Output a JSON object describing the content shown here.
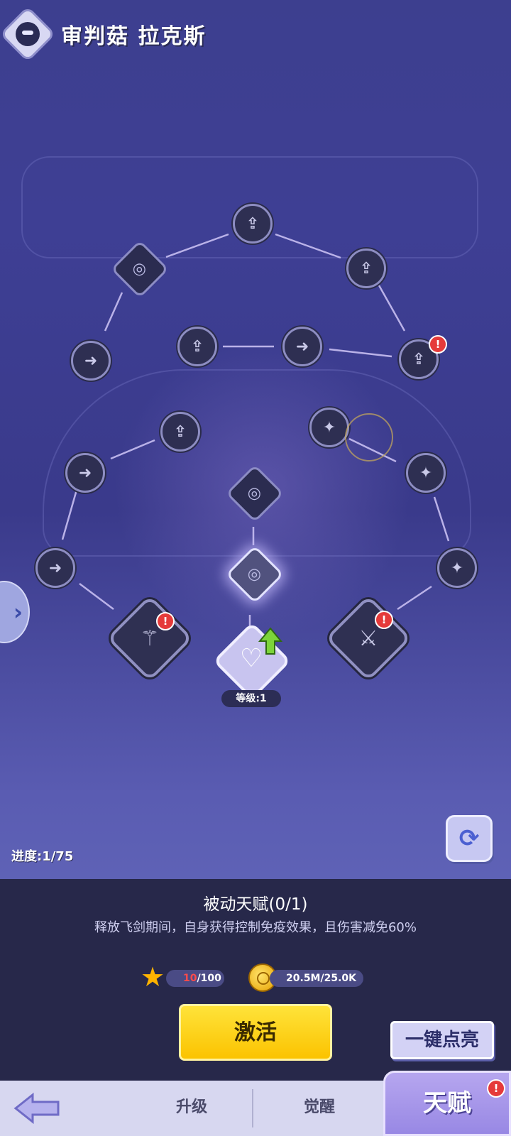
{
  "header": {
    "title": "审判菇 拉克斯",
    "avatar_icon": "hooded-mushroom-icon"
  },
  "tree": {
    "level_label": "等级:1",
    "badge_text": "!",
    "icons": {
      "node_small": "talent-node-icon",
      "node_diamond": "vortex-diamond-icon",
      "staff": "staff-icon",
      "sword": "sword-icon",
      "heart": "heart-plus-icon",
      "upgrade": "green-up-arrow-icon"
    }
  },
  "progress": "进度:1/75",
  "panel": {
    "title": "被动天赋(0/1)",
    "description": "释放飞剑期间，自身获得控制免疫效果，且伤害减免60%",
    "cost_star_current": "10",
    "cost_star_total": "/100",
    "cost_gold": "20.5M/25.0K",
    "activate_label": "激活",
    "one_key_label": "一键点亮"
  },
  "tabs": {
    "upgrade": "升级",
    "awaken": "觉醒",
    "talent": "天赋"
  },
  "colors": {
    "activate": "#fbc300",
    "badge": "#e53a3a",
    "panel_bg": "#27284a"
  }
}
